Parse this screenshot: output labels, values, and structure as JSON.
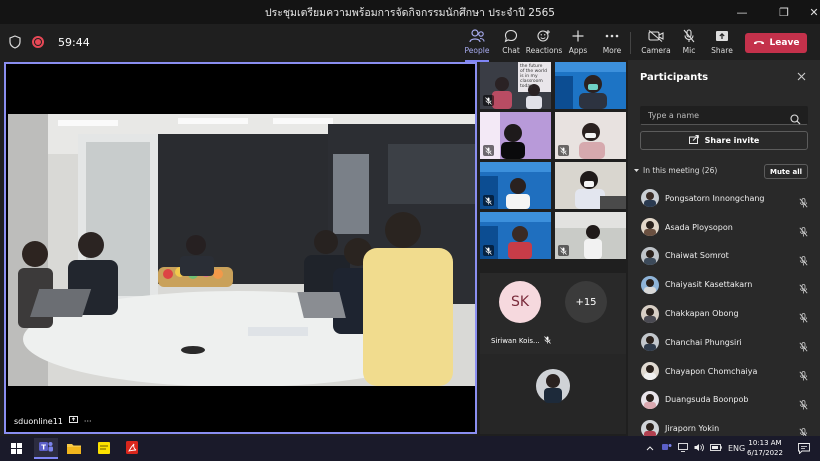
{
  "window": {
    "title": "ประชุมเตรียมความพร้อมการจัดกิจกรรมนักศึกษา ประจำปี 2565",
    "minimize_glyph": "—",
    "maximize_glyph": "❐",
    "close_glyph": "✕"
  },
  "toolbar": {
    "timer": "59:44",
    "people_label": "People",
    "chat_label": "Chat",
    "reactions_label": "Reactions",
    "apps_label": "Apps",
    "more_label": "More",
    "camera_label": "Camera",
    "mic_label": "Mic",
    "share_label": "Share",
    "leave_label": "Leave"
  },
  "main_video": {
    "participant_name": "sduonline11",
    "menu_glyph": "···"
  },
  "gallery": {
    "remaining_count": "+15",
    "tile_sk": {
      "initials": "SK",
      "name": "Siriwan Kois..."
    },
    "thumb_caption": "the future of the world is in my classroom today"
  },
  "participants": {
    "panel_title": "Participants",
    "search_placeholder": "Type a name",
    "share_invite_label": "Share invite",
    "section_label": "In this meeting (26)",
    "mute_all_label": "Mute all",
    "list": [
      {
        "name": "Pongsatorn Innongchang"
      },
      {
        "name": "Asada Ploysopon"
      },
      {
        "name": "Chaiwat Somrot"
      },
      {
        "name": "Chaiyasit Kasettakarn"
      },
      {
        "name": "Chakkapan Obong"
      },
      {
        "name": "Chanchai Phungsiri"
      },
      {
        "name": "Chayapon Chomchaiya"
      },
      {
        "name": "Duangsuda Boonpob"
      },
      {
        "name": "Jiraporn Yokin"
      }
    ]
  },
  "taskbar": {
    "language": "ENG",
    "time": "10:13 AM",
    "date": "6/17/2022"
  },
  "colors": {
    "accent": "#7f85f5",
    "leave": "#c4314b",
    "panel": "#292929",
    "background": "#1f1f1f"
  }
}
